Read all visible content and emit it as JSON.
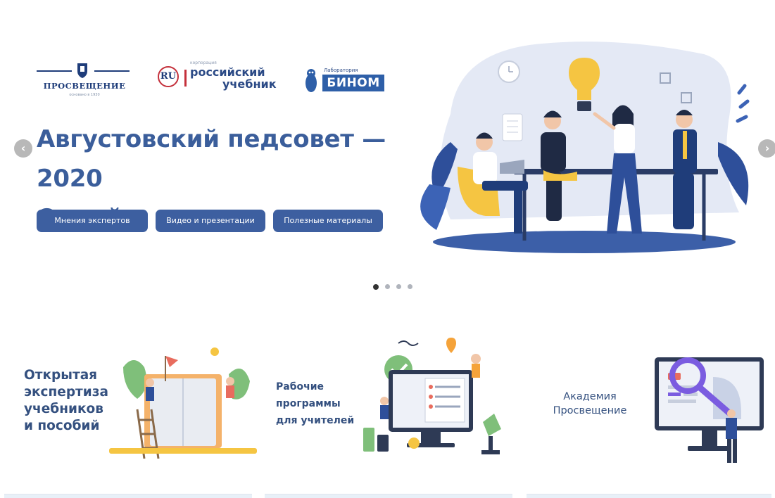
{
  "logos": {
    "prosveshchenie": {
      "name": "ПРОСВЕЩЕНИЕ",
      "tagline": "основано в 1930"
    },
    "rossiysky": {
      "tiny": "корпорация",
      "line1": "российский",
      "line2": "учебник",
      "badge": "RU"
    },
    "binom": {
      "tiny": "Лаборатория",
      "name": "БИНОМ"
    }
  },
  "banner": {
    "headline_line1": "Августовский педсовет — 2020",
    "headline_line2": "Онлайн",
    "buttons": [
      "Мнения экспертов",
      "Видео и презентации",
      "Полезные материалы"
    ],
    "prev_label": "‹",
    "next_label": "›",
    "slide_count": 4,
    "active_slide": 1
  },
  "cards": [
    {
      "title_lines": [
        "Открытая",
        "экспертиза",
        "учебников",
        "и пособий"
      ]
    },
    {
      "title_lines": [
        "Рабочие",
        "программы",
        "для учителей"
      ]
    },
    {
      "title_lines": [
        "Академия",
        "Просвещение"
      ]
    }
  ],
  "colors": {
    "brand_blue": "#3d5fa0",
    "headline_blue": "#3b5e9b",
    "accent_yellow": "#f5c542",
    "accent_purple": "#7a5ce0"
  }
}
